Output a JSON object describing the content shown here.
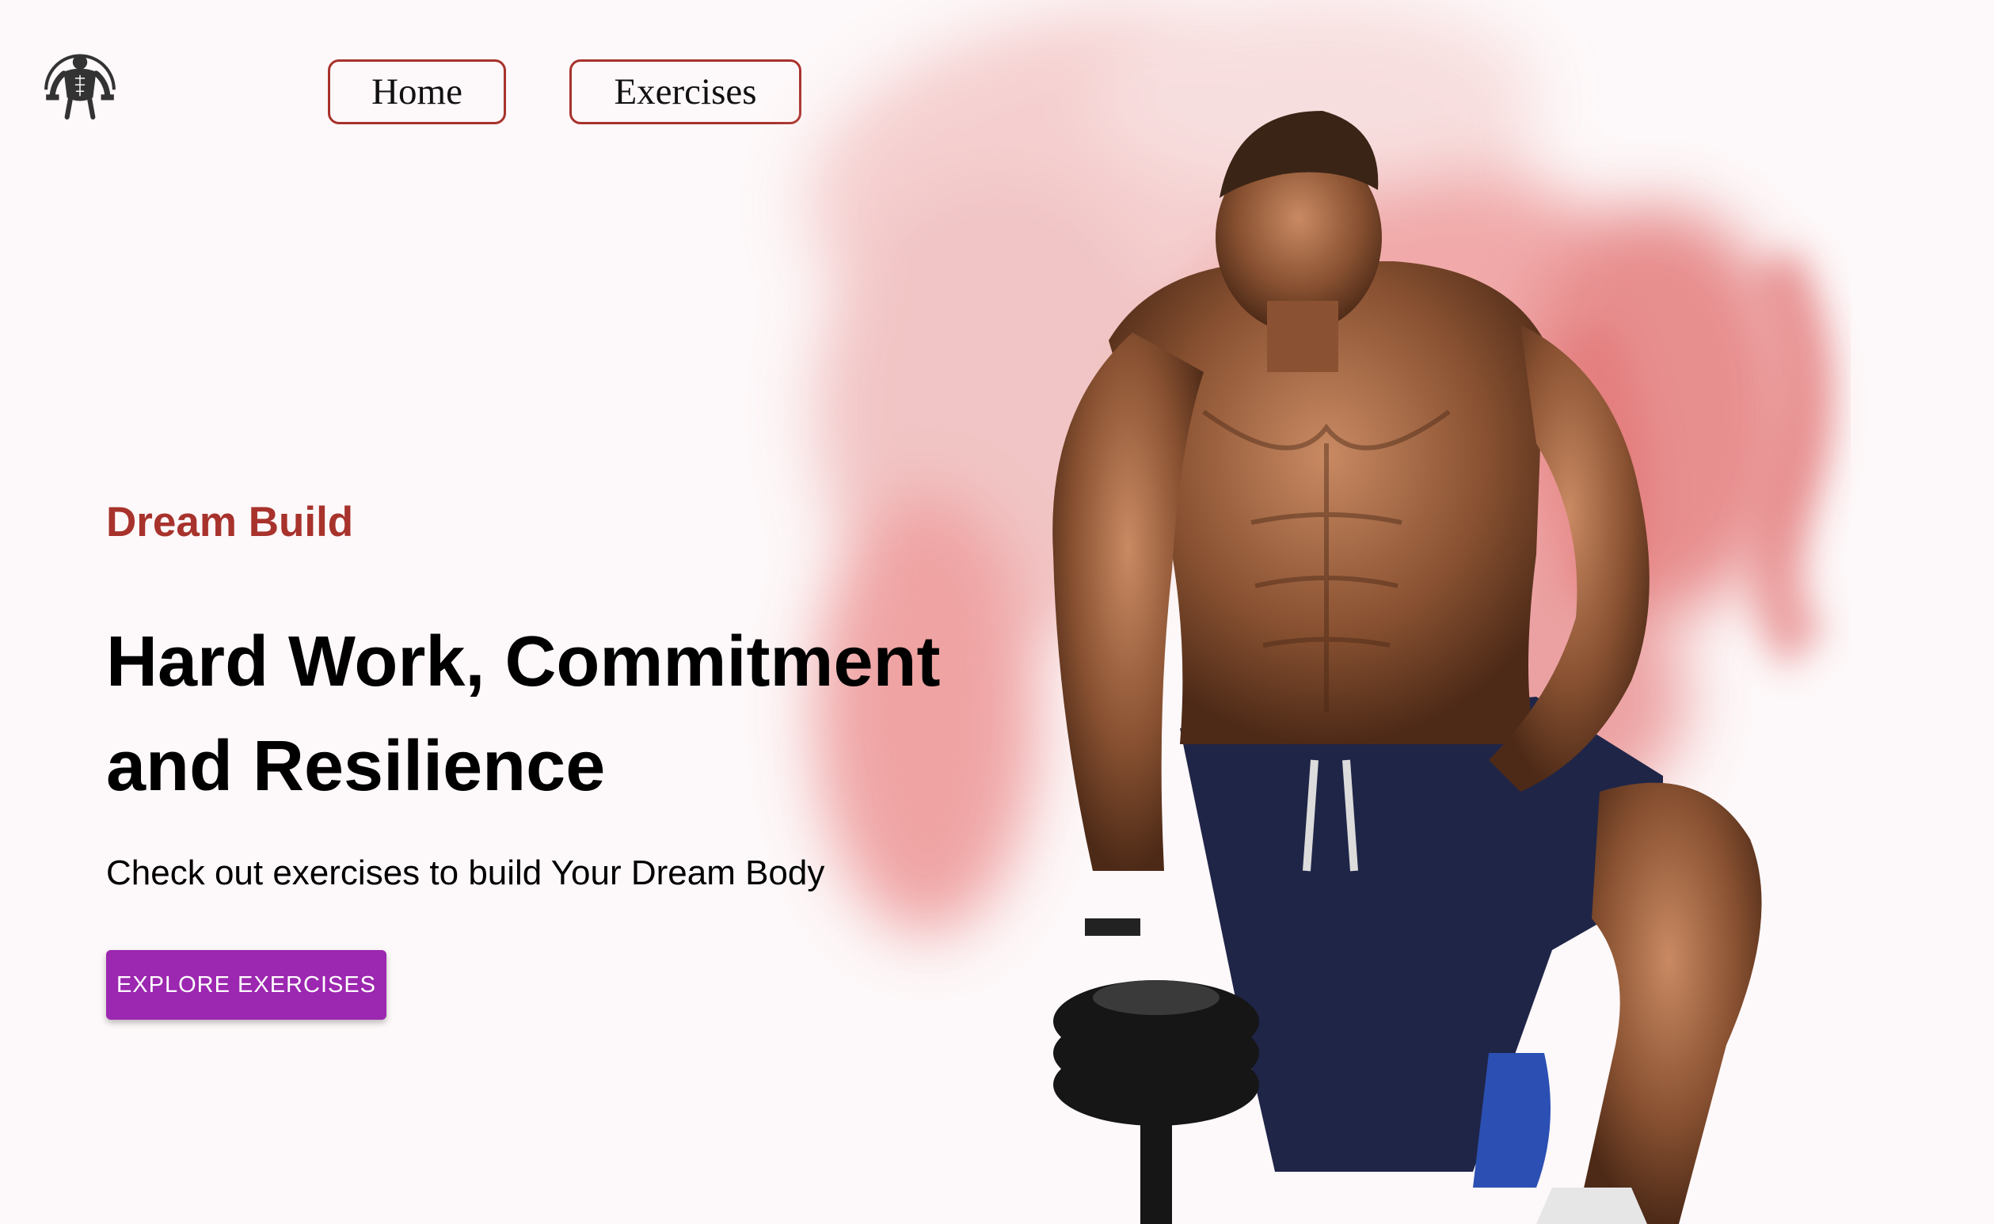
{
  "navbar": {
    "logo_icon": "bodybuilder-logo-icon",
    "home_label": "Home",
    "exercises_label": "Exercises",
    "accent_color": "#a8322c"
  },
  "hero": {
    "eyebrow": "Dream Build",
    "headline_line1": "Hard Work, Commitment",
    "headline_line2": "and Resilience",
    "subtitle": "Check out exercises to build Your Dream Body",
    "cta_label": "EXPLORE EXERCISES",
    "cta_color": "#9c27b0",
    "image_icon": "athlete-with-dumbbell-image"
  }
}
